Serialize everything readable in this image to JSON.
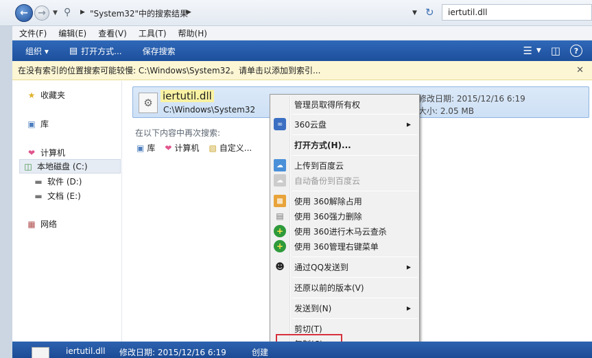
{
  "address": {
    "path": "\"System32\"中的搜索结果",
    "search_value": "iertutil.dll"
  },
  "menubar": [
    "文件(F)",
    "编辑(E)",
    "查看(V)",
    "工具(T)",
    "帮助(H)"
  ],
  "toolbar": {
    "organize": "组织 ▾",
    "open_with": "打开方式...",
    "save_search": "保存搜索"
  },
  "infobar": {
    "text": "在没有索引的位置搜索可能较慢: C:\\Windows\\System32。请单击以添加到索引..."
  },
  "sidebar": {
    "favorites": "收藏夹",
    "libraries": "库",
    "computer": "计算机",
    "local_disk": "本地磁盘 (C:)",
    "software": "软件 (D:)",
    "documents": "文档 (E:)",
    "network": "网络"
  },
  "result": {
    "filename": "iertutil.dll",
    "path": "C:\\Windows\\System32",
    "modified": "修改日期: 2015/12/16 6:19",
    "size": "大小: 2.05 MB"
  },
  "search_again": {
    "label": "在以下内容中再次搜索:",
    "links": [
      "库",
      "计算机",
      "自定义..."
    ]
  },
  "context_menu": {
    "items": [
      "管理员取得所有权",
      "360云盘",
      "打开方式(H)...",
      "上传到百度云",
      "自动备份到百度云",
      "使用 360解除占用",
      "使用 360强力删除",
      "使用 360进行木马云查杀",
      "使用 360管理右键菜单",
      "通过QQ发送到",
      "还原以前的版本(V)",
      "发送到(N)",
      "剪切(T)",
      "复制(C)"
    ]
  },
  "statusbar": {
    "filename": "iertutil.dll",
    "modified": "修改日期: 2015/12/16 6:19",
    "created": "创建"
  },
  "colors": {
    "toolbar_blue": "#1d4f9c",
    "highlight_red": "#d6303a",
    "infobar_yellow": "#fcf6d4",
    "selection_blue": "#cde0f5"
  }
}
